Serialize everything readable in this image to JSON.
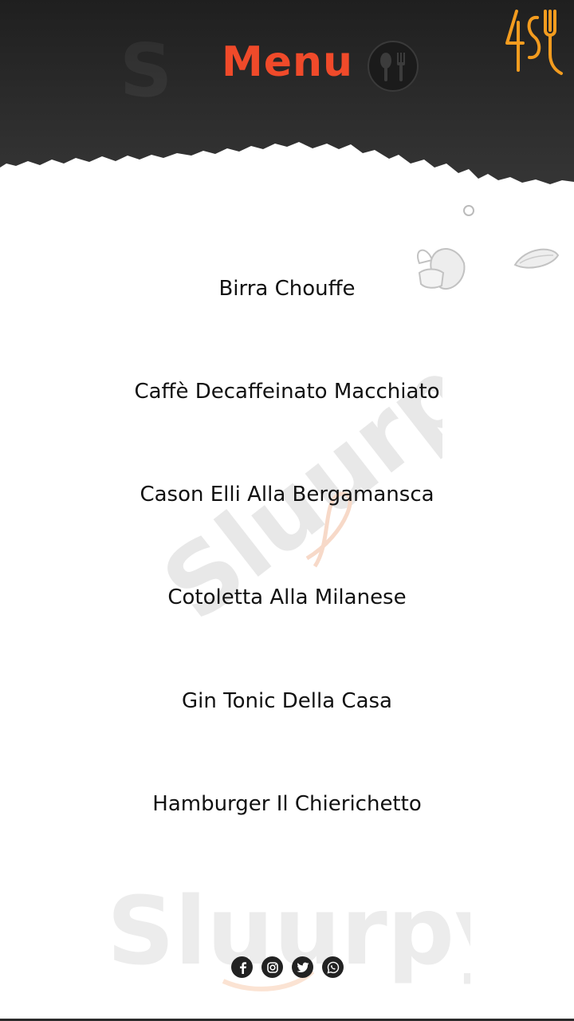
{
  "header": {
    "title": "Menu",
    "menu_icon": "cutlery-icon",
    "brand_logo_icon": "brand-4sc-logo-icon"
  },
  "menu": {
    "items": [
      {
        "label": "Birra Chouffe"
      },
      {
        "label": "Caffè Decaffeinato Macchiato"
      },
      {
        "label": "Cason Elli Alla Bergamansca"
      },
      {
        "label": "Cotoletta Alla Milanese"
      },
      {
        "label": "Gin Tonic Della Casa"
      },
      {
        "label": "Hamburger Il Chierichetto"
      }
    ]
  },
  "social": {
    "links": [
      {
        "name": "facebook-icon"
      },
      {
        "name": "instagram-icon"
      },
      {
        "name": "twitter-icon"
      },
      {
        "name": "whatsapp-icon"
      }
    ]
  },
  "watermark": {
    "text": "Sluurpy"
  },
  "colors": {
    "accent": "#f04a2a",
    "header_bg": "#262626",
    "logo": "#f39c1f",
    "text": "#111111"
  }
}
